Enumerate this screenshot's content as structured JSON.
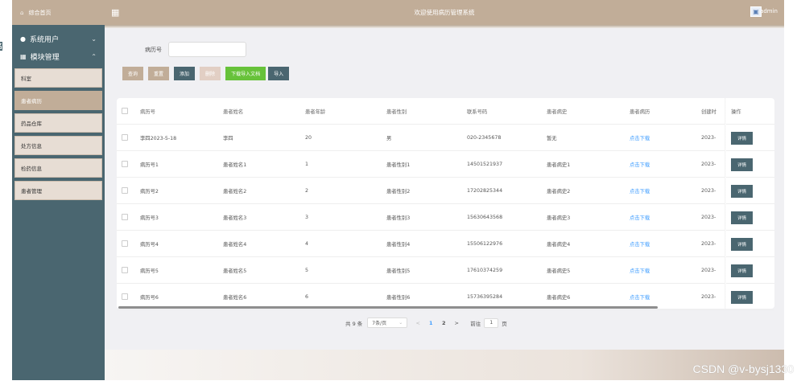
{
  "sidebar": {
    "home": {
      "icon": "home-icon",
      "label": "综合首页"
    },
    "stub": "名",
    "user_group": {
      "icon": "user-icon",
      "label": "系统用户",
      "chevron": "⌄"
    },
    "module_group": {
      "icon": "grid-icon",
      "label": "模块管理",
      "chevron": "⌃"
    },
    "items": [
      {
        "label": "科室",
        "active": false
      },
      {
        "label": "患者病历",
        "active": true
      },
      {
        "label": "药品仓库",
        "active": false
      },
      {
        "label": "处方信息",
        "active": false
      },
      {
        "label": "检药信息",
        "active": false
      },
      {
        "label": "患者管理",
        "active": false
      }
    ]
  },
  "topbar": {
    "title": "欢迎使用病历管理系统",
    "user": "admin"
  },
  "filter": {
    "label": "病历号",
    "value": "",
    "placeholder": ""
  },
  "toolbar": {
    "query": "查询",
    "reset": "重置",
    "add": "添加",
    "delete": "删除",
    "download": "下载导入文档",
    "import": "导入"
  },
  "table": {
    "headers": [
      "病历号",
      "患者姓名",
      "患者年龄",
      "患者性别",
      "联系号码",
      "患者病史",
      "患者病历",
      "创建时",
      "操作"
    ],
    "rows": [
      {
        "id": "李四2023-5-18",
        "name": "李四",
        "age": "20",
        "gender": "男",
        "phone": "020-2345678",
        "history": "暂无",
        "record": "点击下载",
        "created": "2023-",
        "action": "详情"
      },
      {
        "id": "病历号1",
        "name": "患者姓名1",
        "age": "1",
        "gender": "患者性别1",
        "phone": "14501521937",
        "history": "患者病史1",
        "record": "点击下载",
        "created": "2023-",
        "action": "详情"
      },
      {
        "id": "病历号2",
        "name": "患者姓名2",
        "age": "2",
        "gender": "患者性别2",
        "phone": "17202825344",
        "history": "患者病史2",
        "record": "点击下载",
        "created": "2023-",
        "action": "详情"
      },
      {
        "id": "病历号3",
        "name": "患者姓名3",
        "age": "3",
        "gender": "患者性别3",
        "phone": "15630643568",
        "history": "患者病史3",
        "record": "点击下载",
        "created": "2023-",
        "action": "详情"
      },
      {
        "id": "病历号4",
        "name": "患者姓名4",
        "age": "4",
        "gender": "患者性别4",
        "phone": "15506122976",
        "history": "患者病史4",
        "record": "点击下载",
        "created": "2023-",
        "action": "详情"
      },
      {
        "id": "病历号5",
        "name": "患者姓名5",
        "age": "5",
        "gender": "患者性别5",
        "phone": "17610374259",
        "history": "患者病史5",
        "record": "点击下载",
        "created": "2023-",
        "action": "详情"
      },
      {
        "id": "病历号6",
        "name": "患者姓名6",
        "age": "6",
        "gender": "患者性别6",
        "phone": "15736395284",
        "history": "患者病史6",
        "record": "点击下载",
        "created": "2023-",
        "action": "详情"
      }
    ]
  },
  "pager": {
    "total": "共 9 条",
    "size": "7条/页",
    "prev": "<",
    "pages": [
      "1",
      "2"
    ],
    "current": "1",
    "next": ">",
    "goto_label": "前往",
    "goto_value": "1",
    "page_unit": "页"
  },
  "watermark": "CSDN @v-bysj1330",
  "colors": {
    "accent": "#c1ad98",
    "sidebar": "#4a6670",
    "green": "#67c23a",
    "link": "#409eff"
  }
}
